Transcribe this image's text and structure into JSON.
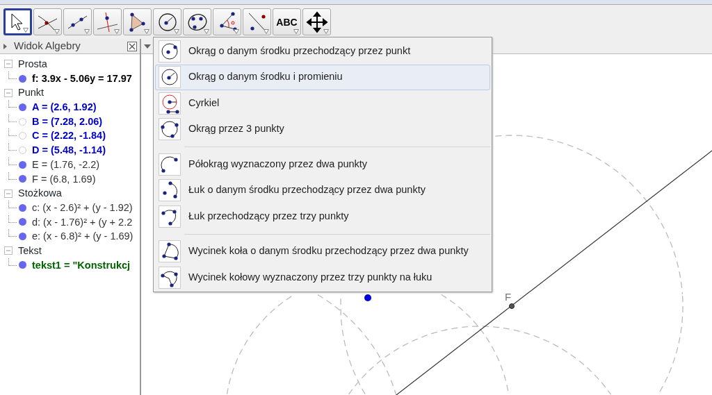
{
  "toolbar": {
    "tools": [
      {
        "selected": true
      },
      {
        "selected": false
      },
      {
        "selected": false
      },
      {
        "selected": false
      },
      {
        "selected": false
      },
      {
        "selected": false
      },
      {
        "selected": false
      },
      {
        "selected": false
      },
      {
        "selected": false
      },
      {
        "selected": false,
        "label": "ABC"
      },
      {
        "selected": false
      }
    ]
  },
  "algebra_view": {
    "title": "Widok Algebry",
    "groups": [
      {
        "label": "Prosta",
        "expanded": true,
        "children": [
          {
            "text": "f: 3.9x - 5.06y = 17.97",
            "shown": true,
            "color": "#000000"
          }
        ]
      },
      {
        "label": "Punkt",
        "expanded": true,
        "children": [
          {
            "text": "A = (2.6, 1.92)",
            "shown": true,
            "color": "#0000cc"
          },
          {
            "text": "B = (7.28, 2.06)",
            "shown": false,
            "color": "#0000cc"
          },
          {
            "text": "C = (2.22, -1.84)",
            "shown": false,
            "color": "#0000cc"
          },
          {
            "text": "D = (5.48, -1.14)",
            "shown": false,
            "color": "#0000cc"
          },
          {
            "text": "E = (1.76, -2.2)",
            "shown": true,
            "color": "#333333"
          },
          {
            "text": "F = (6.8, 1.69)",
            "shown": true,
            "color": "#333333"
          }
        ]
      },
      {
        "label": "Stożkowa",
        "expanded": true,
        "children": [
          {
            "text": "c: (x - 2.6)² + (y - 1.92)",
            "shown": true,
            "color": "#333333"
          },
          {
            "text": "d: (x - 1.76)² + (y + 2.2",
            "shown": true,
            "color": "#333333"
          },
          {
            "text": "e: (x - 6.8)² + (y - 1.69)",
            "shown": true,
            "color": "#333333"
          }
        ]
      },
      {
        "label": "Tekst",
        "expanded": true,
        "children": [
          {
            "text": "tekst1 = \"Konstrukcj",
            "shown": true,
            "color": "#006400"
          }
        ]
      }
    ]
  },
  "graphics": {
    "point_label": "F"
  },
  "tool_menu": {
    "groups": [
      [
        {
          "label": "Okrąg o danym środku przechodzący przez punkt",
          "selected": false
        },
        {
          "label": "Okrąg o danym środku i promieniu",
          "selected": true
        },
        {
          "label": "Cyrkiel",
          "selected": false
        },
        {
          "label": "Okrąg przez 3 punkty",
          "selected": false
        }
      ],
      [
        {
          "label": "Półokrąg wyznaczony przez dwa punkty",
          "selected": false
        },
        {
          "label": "Łuk o danym środku przechodzący przez dwa punkty",
          "selected": false
        },
        {
          "label": "Łuk przechodzący przez trzy punkty",
          "selected": false
        }
      ],
      [
        {
          "label": "Wycinek koła o danym środku przechodzący przez dwa punkty",
          "selected": false
        },
        {
          "label": "Wycinek kołowy wyznaczony przez trzy punkty na łuku",
          "selected": false
        }
      ]
    ]
  }
}
